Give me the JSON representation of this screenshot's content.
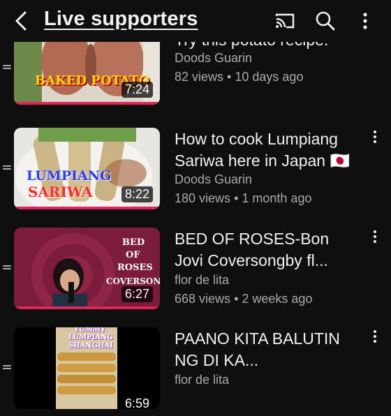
{
  "header": {
    "title": "Live supporters",
    "icons": [
      "back-arrow-icon",
      "cast-icon",
      "search-icon",
      "more-vert-icon"
    ]
  },
  "videos": [
    {
      "title": "Try this potato recipe.",
      "channel": "Doods Guarin",
      "views": "82 views",
      "age": "10 days ago",
      "duration": "7:24",
      "thumb_text": "BAKED POTATO"
    },
    {
      "title": "How to cook Lumpiang Sariwa here in Japan 🇯🇵",
      "channel": "Doods Guarin",
      "views": "180 views",
      "age": "1 month ago",
      "duration": "8:22",
      "thumb_text_1": "LUMPIANG",
      "thumb_text_2": "SARIWA"
    },
    {
      "title": "BED OF ROSES-Bon Jovi Coversongby fl...",
      "channel": "flor de lita",
      "views": "668 views",
      "age": "2 weeks ago",
      "duration": "6:27",
      "thumb_text_1": "BED",
      "thumb_text_2": "OF",
      "thumb_text_3": "ROSES",
      "thumb_text_4": "COVERSONG"
    },
    {
      "title": "PAANO KITA BALUTIN NG DI KA...",
      "channel": "flor de lita",
      "duration": "6:59",
      "thumb_text_1": "YUMMY",
      "thumb_text_2": "LUMPIANG",
      "thumb_text_3": "SHANGHAI"
    }
  ],
  "separator": "•",
  "colors": {
    "background": "#0f0f0f",
    "progress": "#e0245e",
    "secondary_text": "#aaaaaa"
  }
}
